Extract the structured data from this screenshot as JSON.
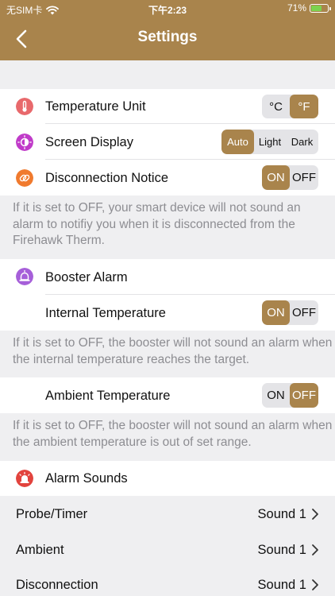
{
  "status": {
    "carrier": "无SIM卡",
    "time": "下午2:23",
    "battery": "71%",
    "battery_level": 0.71
  },
  "nav": {
    "title": "Settings"
  },
  "temperature_unit": {
    "label": "Temperature Unit",
    "options": [
      "°C",
      "°F"
    ],
    "selected": "°F"
  },
  "screen_display": {
    "label": "Screen Display",
    "options": [
      "Auto",
      "Light",
      "Dark"
    ],
    "selected": "Auto"
  },
  "disconnection_notice": {
    "label": "Disconnection Notice",
    "on": "ON",
    "off": "OFF",
    "state": "ON",
    "note": "If it is set to OFF, your smart device will not sound an alarm to notifiy you when it is disconnected from the Firehawk Therm."
  },
  "booster_alarm": {
    "label": "Booster Alarm"
  },
  "internal_temperature": {
    "label": "Internal Temperature",
    "on": "ON",
    "off": "OFF",
    "state": "ON",
    "note": "If it is set to OFF, the booster will not sound an alarm when the internal temperature reaches the target."
  },
  "ambient_temperature": {
    "label": "Ambient Temperature",
    "on": "ON",
    "off": "OFF",
    "state": "OFF",
    "note": "If it is set to OFF, the booster will not sound an alarm when the ambient temperature is out of set range."
  },
  "alarm_sounds": {
    "label": "Alarm Sounds",
    "items": [
      {
        "label": "Probe/Timer",
        "value": "Sound 1"
      },
      {
        "label": "Ambient",
        "value": "Sound 1"
      },
      {
        "label": "Disconnection",
        "value": "Sound 1"
      }
    ]
  },
  "colors": {
    "accent": "#a9844c",
    "temp_icon": "#e8696c",
    "screen_icon": "#c03bc9",
    "disconnect_icon": "#f07a2e",
    "booster_icon": "#a65fd9",
    "alarm_icon": "#e2433d"
  }
}
